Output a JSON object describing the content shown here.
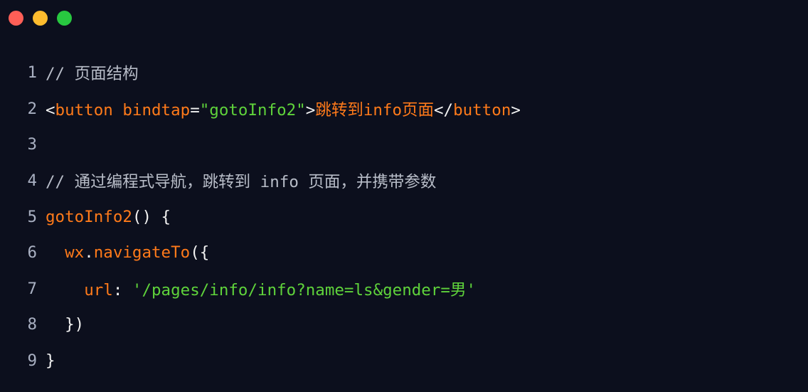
{
  "window": {
    "controls": [
      "close",
      "minimize",
      "maximize"
    ]
  },
  "code": {
    "lines": [
      {
        "num": "1",
        "t1": "// 页面结构"
      },
      {
        "num": "2",
        "t1": "<",
        "t2": "button",
        "t3": " ",
        "t4": "bindtap",
        "t5": "=",
        "t6": "\"gotoInfo2\"",
        "t7": ">",
        "t8": "跳转到info页面",
        "t9": "</",
        "t10": "button",
        "t11": ">"
      },
      {
        "num": "3"
      },
      {
        "num": "4",
        "t1": "// 通过编程式导航，跳转到 info 页面，并携带参数"
      },
      {
        "num": "5",
        "t1": "gotoInfo2",
        "t2": "() {"
      },
      {
        "num": "6",
        "t1": "  ",
        "t2": "wx",
        "t3": ".",
        "t4": "navigateTo",
        "t5": "({"
      },
      {
        "num": "7",
        "t1": "    ",
        "t2": "url",
        "t3": ": ",
        "t4": "'/pages/info/info?name=ls&gender=男'"
      },
      {
        "num": "8",
        "t1": "  })"
      },
      {
        "num": "9",
        "t1": "}"
      }
    ]
  },
  "colors": {
    "background": "#0c0f1d",
    "keyword": "#ff7a1a",
    "string": "#5fd33b",
    "comment": "#b8bdc8",
    "line_number": "#a9b0c2"
  }
}
